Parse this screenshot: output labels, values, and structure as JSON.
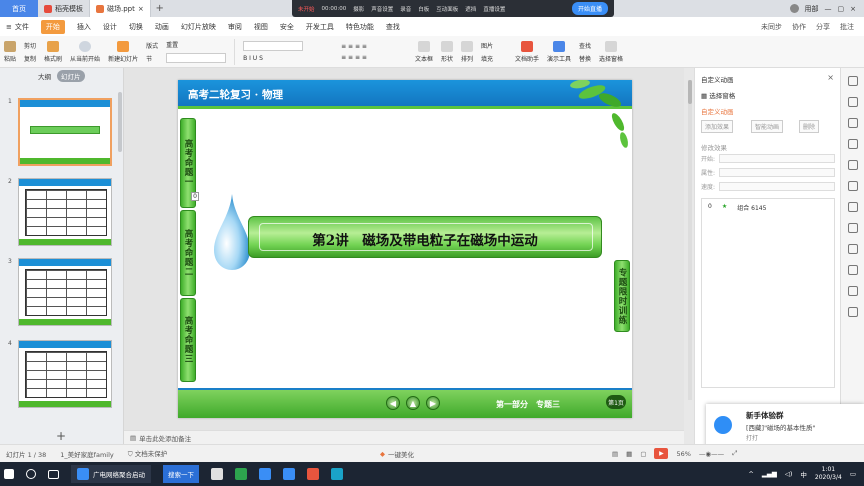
{
  "tabs": {
    "home": "首页",
    "items": [
      {
        "label": "稻壳模板",
        "active": false
      },
      {
        "label": "磁场.ppt",
        "active": true
      }
    ],
    "add": "+",
    "user": "用部"
  },
  "recorder": {
    "status": "未开始",
    "time": "00:00:00",
    "items": [
      "摄影",
      "声音设置",
      "录音",
      "白板",
      "互动面板",
      "遮挡",
      "直播设置"
    ],
    "start": "开始直播"
  },
  "menu": {
    "file": "文件",
    "items": [
      "开始",
      "插入",
      "设计",
      "切换",
      "动画",
      "幻灯片放映",
      "审阅",
      "视图",
      "安全",
      "开发工具",
      "特色功能",
      "查找"
    ],
    "active": "开始",
    "right": [
      "未同步",
      "协作",
      "分享",
      "批注"
    ]
  },
  "ribbon": {
    "paste": "粘贴",
    "cut": "剪切",
    "copy": "复制",
    "format_painter": "格式刷",
    "from_current": "从当前开始",
    "new_slide": "新建幻灯片",
    "layout": "版式",
    "section": "节",
    "reset": "重置",
    "textbox": "文本框",
    "shape": "形状",
    "arrange": "排列",
    "picture": "图片",
    "fill": "填充",
    "text_assistant": "文档助手",
    "presenter_assistant": "演示工具",
    "find": "查找",
    "replace": "替换",
    "select_pane": "选择窗格"
  },
  "left_panel": {
    "tabs": [
      "大纲",
      "幻灯片"
    ],
    "active_tab": "幻灯片",
    "slides": [
      1,
      2,
      3,
      4
    ],
    "selected": 1
  },
  "slide": {
    "header_title": "高考二轮复习 · 物理",
    "left_tabs": [
      "高考命题一",
      "高考命题二",
      "高考命题三"
    ],
    "right_tab": "专题限时训练",
    "lesson": "第2讲　磁场及带电粒子在磁场中运动",
    "zero_badge": "0",
    "footer_label": "第一部分　专题三",
    "page_badge": "第1页",
    "nav": [
      "◀",
      "▲",
      "▶"
    ]
  },
  "notes": {
    "placeholder": "单击此处添加备注"
  },
  "right_panel": {
    "title": "自定义动画",
    "select_pane": "选择窗格",
    "subtitle": "自定义动画",
    "add_effect": "添加效果",
    "smart_anim": "智能动画",
    "delete": "删除",
    "modify_label": "修改效果",
    "fields": [
      "开始:",
      "属性:",
      "速度:"
    ],
    "anim_items": [
      {
        "index": "0",
        "name": "组合 6145"
      }
    ]
  },
  "toast": {
    "title": "新手体验群",
    "message": "[西藏]\"磁场的基本性质\"",
    "sub": "打打"
  },
  "statusbar": {
    "slide_info": "幻灯片 1 / 38",
    "theme": "1_美好家庭family",
    "protect": "文档未保护",
    "beautify": "一键美化",
    "zoom": "56%"
  },
  "taskbar": {
    "app": "广电网络聚合启动",
    "search": "搜索一下",
    "time": "1:01",
    "date": "2020/3/4",
    "ime": "中"
  },
  "colors": {
    "accent_orange": "#f39a3e",
    "slide_blue": "#1b94dc",
    "slide_green": "#4fb82d"
  }
}
